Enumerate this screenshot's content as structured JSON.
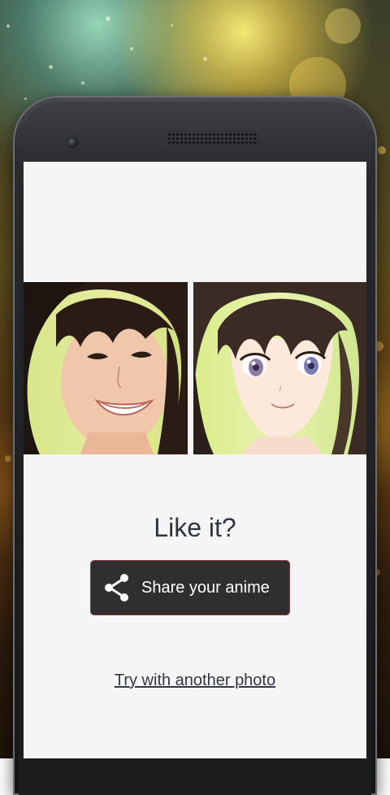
{
  "colors": {
    "screen_background": "#f5f5f5",
    "button_background": "#2f2f2f",
    "button_text": "#ffffff",
    "title_text": "#2f3640"
  },
  "result": {
    "original_photo_alt": "Original photo",
    "anime_photo_alt": "Anime version"
  },
  "prompt": {
    "title": "Like it?"
  },
  "share_button": {
    "label": "Share your anime",
    "icon": "share-icon"
  },
  "retry_link": {
    "label": "Try with another photo"
  }
}
